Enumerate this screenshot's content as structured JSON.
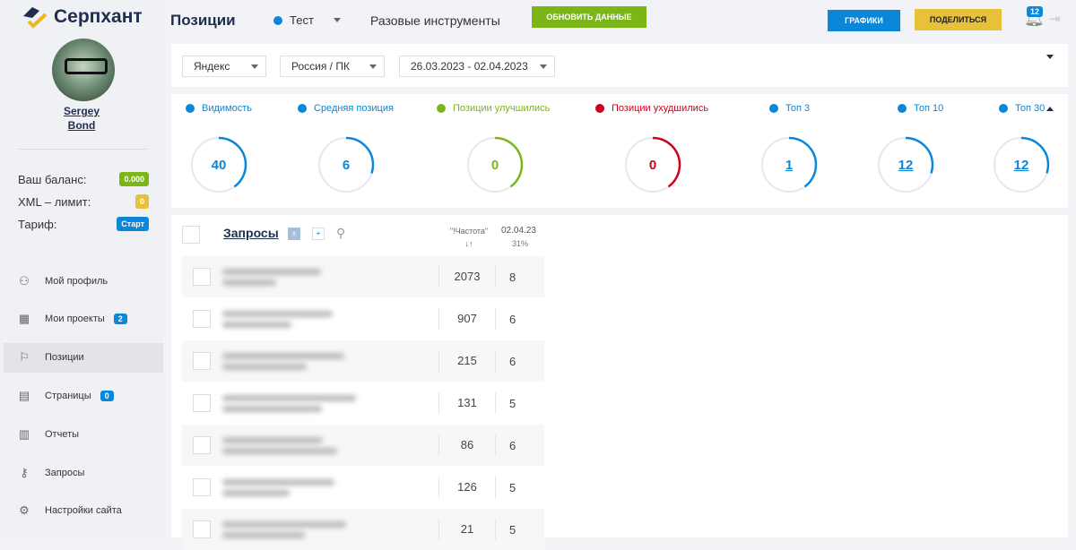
{
  "brand": "Серпхант",
  "user": {
    "first": "Sergey",
    "last": "Bond"
  },
  "account": [
    {
      "label": "Ваш баланс:",
      "value": "0.000",
      "color": "#7cb518"
    },
    {
      "label": "XML – лимит:",
      "value": "0",
      "color": "#e8c13a"
    },
    {
      "label": "Тариф:",
      "value": "Старт",
      "color": "#0a87d9"
    }
  ],
  "nav": [
    {
      "label": "Мой профиль",
      "icon": "user-icon"
    },
    {
      "label": "Мои проекты",
      "icon": "grid-icon",
      "badge": "2"
    },
    {
      "label": "Позиции",
      "icon": "flag-icon",
      "active": true
    },
    {
      "label": "Страницы",
      "icon": "pages-icon",
      "badge": "0"
    },
    {
      "label": "Отчеты",
      "icon": "report-icon"
    },
    {
      "label": "Запросы",
      "icon": "key-icon"
    },
    {
      "label": "Настройки сайта",
      "icon": "gear-icon"
    }
  ],
  "header": {
    "title": "Позиции",
    "project": "Тест",
    "tools": "Разовые инструменты",
    "update": "ОБНОВИТЬ ДАННЫЕ",
    "charts": "ГРАФИКИ",
    "share": "ПОДЕЛИТЬСЯ",
    "notifications": "12"
  },
  "filters": {
    "engine": "Яндекс",
    "region": "Россия / ПК",
    "dates": "26.03.2023 - 02.04.2023"
  },
  "metrics": [
    {
      "label": "Видимость",
      "value": "40",
      "color": "#0a87d9",
      "fill": 0.4
    },
    {
      "label": "Средняя позиция",
      "value": "6",
      "color": "#0a87d9",
      "fill": 0.3
    },
    {
      "label": "Позиции улучшились",
      "value": "0",
      "color": "#7cb518",
      "fill": 0.4
    },
    {
      "label": "Позиции ухудшились",
      "value": "0",
      "color": "#d0021b",
      "fill": 0.4
    },
    {
      "label": "Топ 3",
      "value": "1",
      "color": "#0a87d9",
      "fill": 0.4
    },
    {
      "label": "Топ 10",
      "value": "12",
      "color": "#0a87d9",
      "fill": 0.3
    },
    {
      "label": "Топ 30",
      "value": "12",
      "color": "#0a87d9",
      "fill": 0.3
    }
  ],
  "table": {
    "title": "Запросы",
    "freq_header": "\"!Частота\"",
    "sort": "↓↑",
    "date": "02.04.23",
    "date_pct": "31%",
    "rows": [
      {
        "freq": "2073",
        "pos": "8"
      },
      {
        "freq": "907",
        "pos": "6"
      },
      {
        "freq": "215",
        "pos": "6"
      },
      {
        "freq": "131",
        "pos": "5"
      },
      {
        "freq": "86",
        "pos": "6"
      },
      {
        "freq": "126",
        "pos": "5"
      },
      {
        "freq": "21",
        "pos": "5"
      }
    ]
  }
}
